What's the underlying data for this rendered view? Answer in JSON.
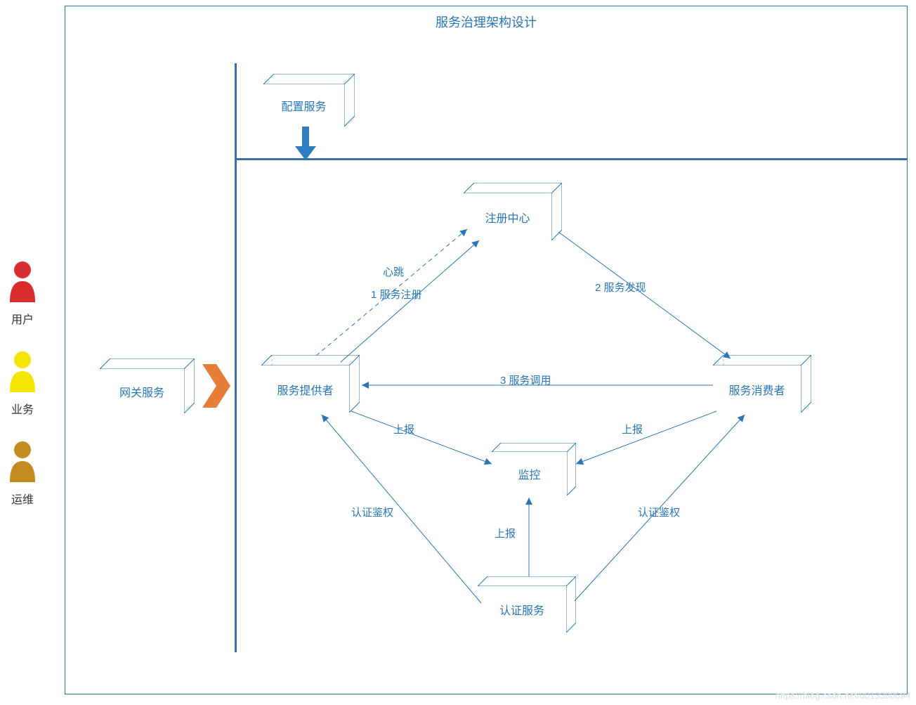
{
  "title": "服务治理架构设计",
  "actors": {
    "user": "用户",
    "business": "业务",
    "ops": "运维"
  },
  "boxes": {
    "config": "配置服务",
    "gateway": "网关服务",
    "provider": "服务提供者",
    "registry": "注册中心",
    "consumer": "服务消费者",
    "monitor": "监控",
    "auth": "认证服务"
  },
  "edges": {
    "heartbeat": "心跳",
    "register": "1 服务注册",
    "discover": "2 服务发现",
    "call": "3 服务调用",
    "report1": "上报",
    "report2": "上报",
    "report3": "上报",
    "auth1": "认证鉴权",
    "auth2": "认证鉴权"
  },
  "watermark": "https://blog.csdn.net/u013380694",
  "colors": {
    "blue": "#2876b8",
    "user": "#d82e2e",
    "business": "#f5e600",
    "ops": "#c28a1f",
    "chevron": "#e67e3a"
  }
}
